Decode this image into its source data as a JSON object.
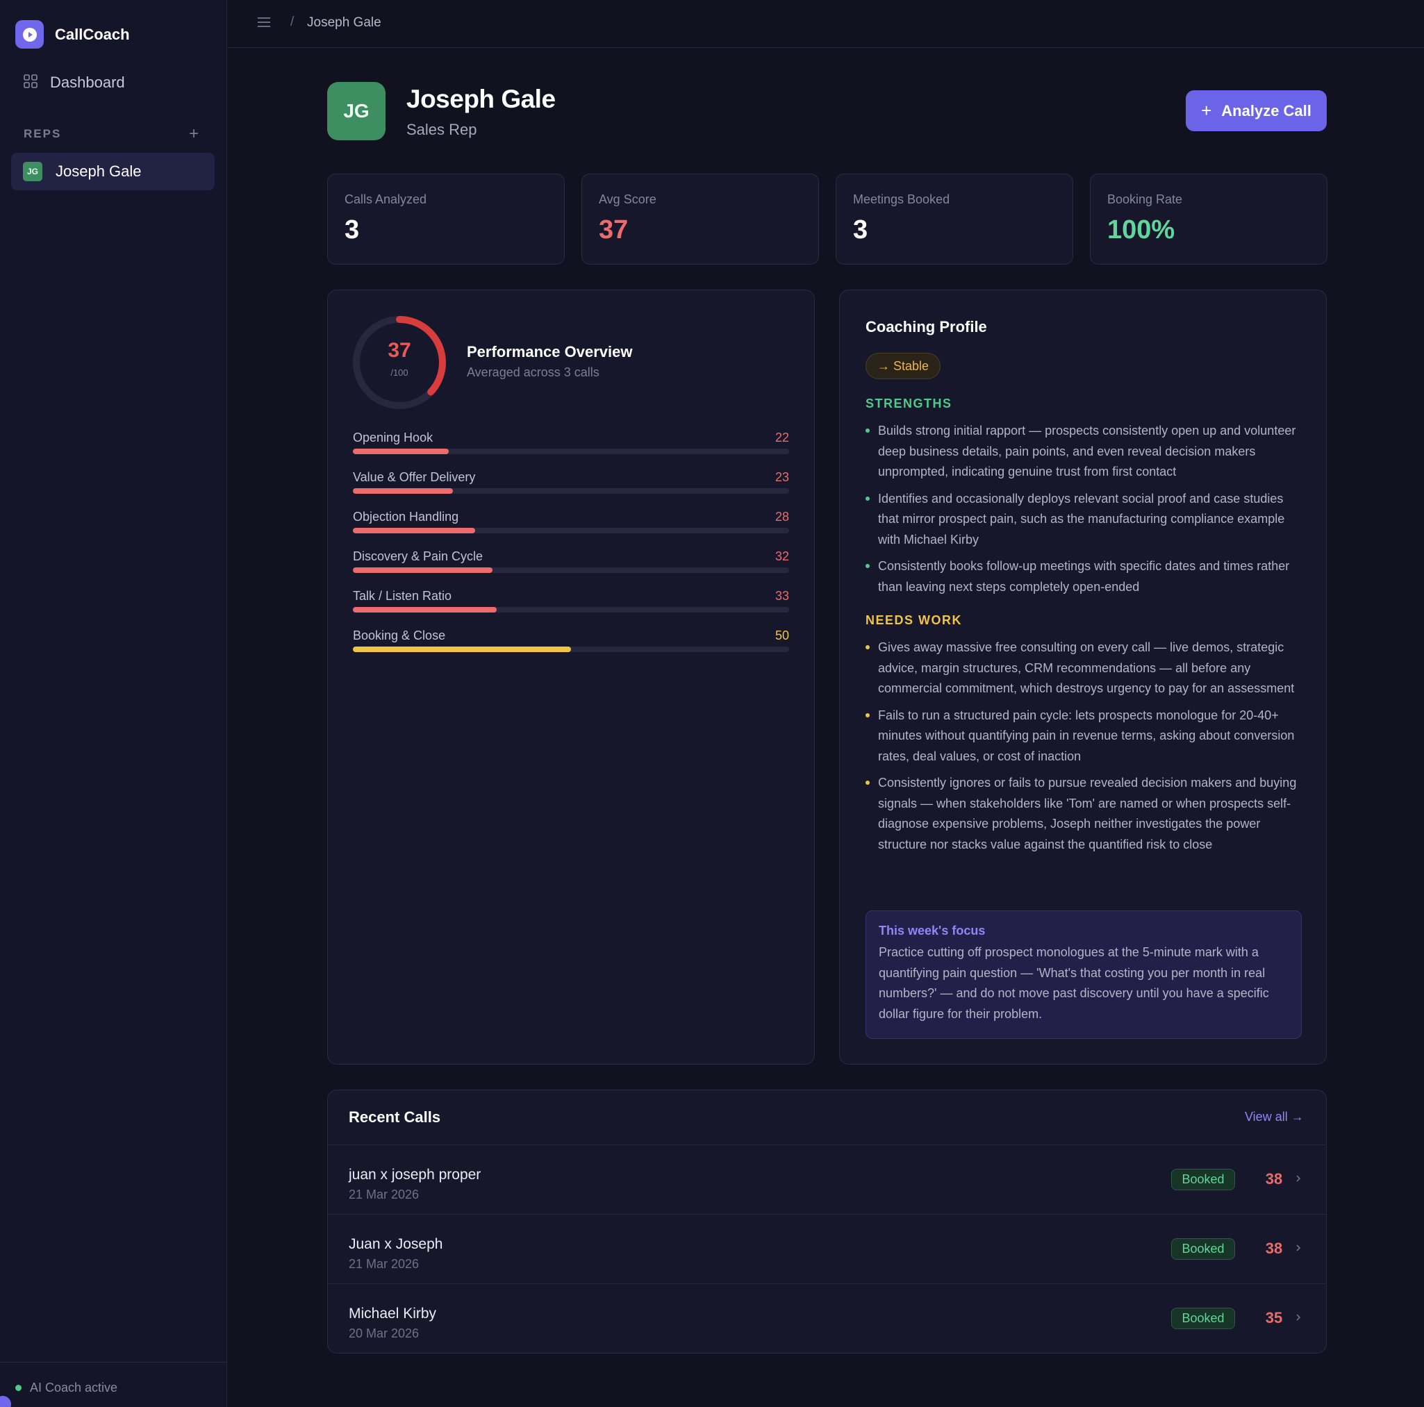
{
  "app": {
    "name": "CallCoach"
  },
  "sidebar": {
    "dashboard_label": "Dashboard",
    "reps_title": "REPS",
    "add_icon": "plus-icon",
    "reps": [
      {
        "initials": "JG",
        "name": "Joseph Gale"
      }
    ],
    "status": "AI Coach active"
  },
  "topbar": {
    "separator": "/",
    "breadcrumb": "Joseph Gale"
  },
  "header": {
    "initials": "JG",
    "name": "Joseph Gale",
    "role": "Sales Rep",
    "analyze_plus": "+",
    "analyze_label": "Analyze Call"
  },
  "stats": [
    {
      "label": "Calls Analyzed",
      "value": "3",
      "color": "#ffffff"
    },
    {
      "label": "Avg Score",
      "value": "37",
      "color": "#ec6b6b"
    },
    {
      "label": "Meetings Booked",
      "value": "3",
      "color": "#ffffff"
    },
    {
      "label": "Booking Rate",
      "value": "100%",
      "color": "#5fd79a"
    }
  ],
  "performance": {
    "title": "Performance Overview",
    "subtitle": "Averaged across 3 calls",
    "score": "37",
    "score_max": "/100",
    "score_fraction": 0.37,
    "metrics": [
      {
        "label": "Opening Hook",
        "value": "22",
        "fraction": 0.22,
        "color": "#ec6b6b"
      },
      {
        "label": "Value & Offer Delivery",
        "value": "23",
        "fraction": 0.23,
        "color": "#ec6b6b"
      },
      {
        "label": "Objection Handling",
        "value": "28",
        "fraction": 0.28,
        "color": "#ec6b6b"
      },
      {
        "label": "Discovery & Pain Cycle",
        "value": "32",
        "fraction": 0.32,
        "color": "#ec6b6b"
      },
      {
        "label": "Talk / Listen Ratio",
        "value": "33",
        "fraction": 0.33,
        "color": "#ec6b6b"
      },
      {
        "label": "Booking & Close",
        "value": "50",
        "fraction": 0.5,
        "color": "#f2c443"
      }
    ]
  },
  "coaching": {
    "title": "Coaching Profile",
    "trend": "→ Stable",
    "strengths_title": "STRENGTHS",
    "strengths": [
      "Builds strong initial rapport — prospects consistently open up and volunteer deep business details, pain points, and even reveal decision makers unprompted, indicating genuine trust from first contact",
      "Identifies and occasionally deploys relevant social proof and case studies that mirror prospect pain, such as the manufacturing compliance example with Michael Kirby",
      "Consistently books follow-up meetings with specific dates and times rather than leaving next steps completely open-ended"
    ],
    "needs_title": "NEEDS WORK",
    "needs_work": [
      "Gives away massive free consulting on every call — live demos, strategic advice, margin structures, CRM recommendations — all before any commercial commitment, which destroys urgency to pay for an assessment",
      "Fails to run a structured pain cycle: lets prospects monologue for 20-40+ minutes without quantifying pain in revenue terms, asking about conversion rates, deal values, or cost of inaction",
      "Consistently ignores or fails to pursue revealed decision makers and buying signals — when stakeholders like 'Tom' are named or when prospects self-diagnose expensive problems, Joseph neither investigates the power structure nor stacks value against the quantified risk to close"
    ],
    "focus_title": "This week's focus",
    "focus_text": "Practice cutting off prospect monologues at the 5-minute mark with a quantifying pain question — 'What's that costing you per month in real numbers?' — and do not move past discovery until you have a specific dollar figure for their problem."
  },
  "recent_calls": {
    "title": "Recent Calls",
    "view_all": "View all →",
    "calls": [
      {
        "name": "juan x joseph proper",
        "date": "21 Mar 2026",
        "status": "Booked",
        "score": "38"
      },
      {
        "name": "Juan x Joseph",
        "date": "21 Mar 2026",
        "status": "Booked",
        "score": "38"
      },
      {
        "name": "Michael Kirby",
        "date": "20 Mar 2026",
        "status": "Booked",
        "score": "35"
      }
    ]
  }
}
